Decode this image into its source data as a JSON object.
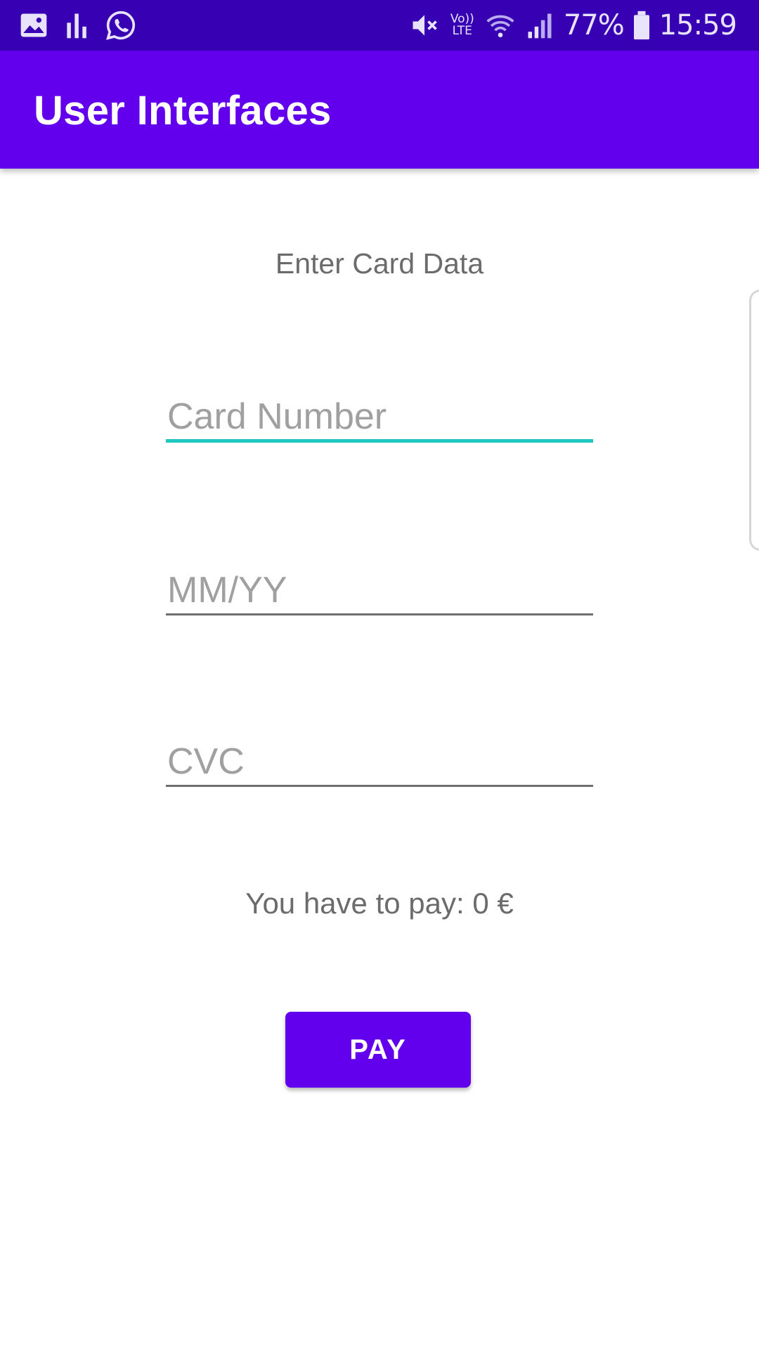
{
  "status_bar": {
    "left_icons": [
      "gallery-icon",
      "bar-chart-icon",
      "whatsapp-icon"
    ],
    "right_icons": [
      "mute-icon",
      "volte-icon",
      "wifi-icon",
      "signal-icon",
      "battery-icon"
    ],
    "volte_line1": "Vo))",
    "volte_line2": "LTE",
    "battery_text": "77%",
    "time": "15:59"
  },
  "app_bar": {
    "title": "User Interfaces"
  },
  "form": {
    "heading": "Enter Card Data",
    "card_number_placeholder": "Card Number",
    "expiry_placeholder": "MM/YY",
    "cvc_placeholder": "CVC",
    "pay_info": "You have to pay: 0 €",
    "pay_button": "PAY"
  },
  "colors": {
    "status_bar": "#3700b3",
    "primary": "#6200ee",
    "focus_accent": "#1ec8c0",
    "secondary_text": "#6b6b6b",
    "hint_text": "#a0a0a0"
  }
}
